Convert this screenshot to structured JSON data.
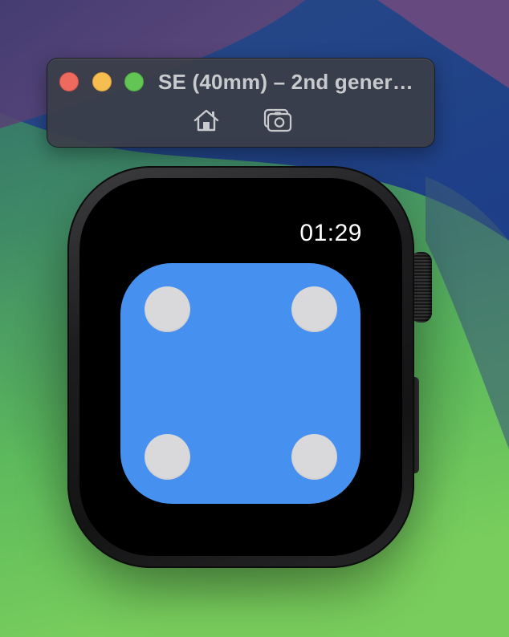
{
  "window": {
    "title": "SE (40mm) – 2nd gener…",
    "controls": {
      "close": "close-icon",
      "minimize": "minimize-icon",
      "zoom": "zoom-icon"
    },
    "toolbar": {
      "home_icon": "home-icon",
      "screenshot_icon": "screenshot-icon"
    }
  },
  "watch": {
    "time": "01:29",
    "dice": {
      "pips": 4,
      "face_color": "#4690ef",
      "pip_color": "#d9d9db"
    }
  },
  "colors": {
    "close": "#ee6a5f",
    "minimize": "#f5be4f",
    "zoom": "#62c554"
  }
}
